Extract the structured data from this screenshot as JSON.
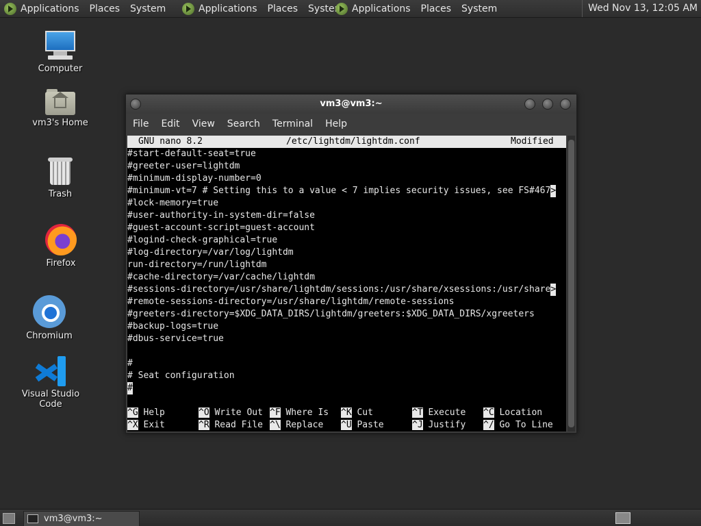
{
  "top_panel": {
    "menus": [
      {
        "items": [
          "Applications",
          "Places",
          "System"
        ]
      },
      {
        "items": [
          "Applications",
          "Places",
          "System"
        ]
      },
      {
        "items": [
          "Applications",
          "Places",
          "System"
        ]
      }
    ],
    "clock": "Wed Nov 13, 12:05 AM"
  },
  "desktop_icons": [
    {
      "label": "Computer",
      "icon": "computer-icon"
    },
    {
      "label": "vm3's Home",
      "icon": "home-folder-icon"
    },
    {
      "label": "Trash",
      "icon": "trash-icon"
    },
    {
      "label": "Firefox",
      "icon": "firefox-icon"
    },
    {
      "label": "Chromium",
      "icon": "chromium-icon"
    },
    {
      "label": "Visual Studio Code",
      "icon": "vscode-icon"
    }
  ],
  "terminal": {
    "title": "vm3@vm3:~",
    "menu": [
      "File",
      "Edit",
      "View",
      "Search",
      "Terminal",
      "Help"
    ],
    "nano": {
      "version": "GNU nano 8.2",
      "file": "/etc/lightdm/lightdm.conf",
      "status": "Modified"
    },
    "lines": [
      "#start-default-seat=true",
      "#greeter-user=lightdm",
      "#minimum-display-number=0",
      "#minimum-vt=7 # Setting this to a value < 7 implies security issues, see FS#467",
      "#lock-memory=true",
      "#user-authority-in-system-dir=false",
      "#guest-account-script=guest-account",
      "#logind-check-graphical=true",
      "#log-directory=/var/log/lightdm",
      "run-directory=/run/lightdm",
      "#cache-directory=/var/cache/lightdm",
      "#sessions-directory=/usr/share/lightdm/sessions:/usr/share/xsessions:/usr/share",
      "#remote-sessions-directory=/usr/share/lightdm/remote-sessions",
      "#greeters-directory=$XDG_DATA_DIRS/lightdm/greeters:$XDG_DATA_DIRS/xgreeters",
      "#backup-logs=true",
      "#dbus-service=true",
      "",
      "#",
      "# Seat configuration",
      "#"
    ],
    "overflow_marker": ">",
    "shortcuts_row1": [
      {
        "key": "^G",
        "label": "Help"
      },
      {
        "key": "^O",
        "label": "Write Out"
      },
      {
        "key": "^F",
        "label": "Where Is"
      },
      {
        "key": "^K",
        "label": "Cut"
      },
      {
        "key": "^T",
        "label": "Execute"
      },
      {
        "key": "^C",
        "label": "Location"
      }
    ],
    "shortcuts_row2": [
      {
        "key": "^X",
        "label": "Exit"
      },
      {
        "key": "^R",
        "label": "Read File"
      },
      {
        "key": "^\\",
        "label": "Replace"
      },
      {
        "key": "^U",
        "label": "Paste"
      },
      {
        "key": "^J",
        "label": "Justify"
      },
      {
        "key": "^/",
        "label": "Go To Line"
      }
    ]
  },
  "taskbar": {
    "task_label": "vm3@vm3:~"
  }
}
